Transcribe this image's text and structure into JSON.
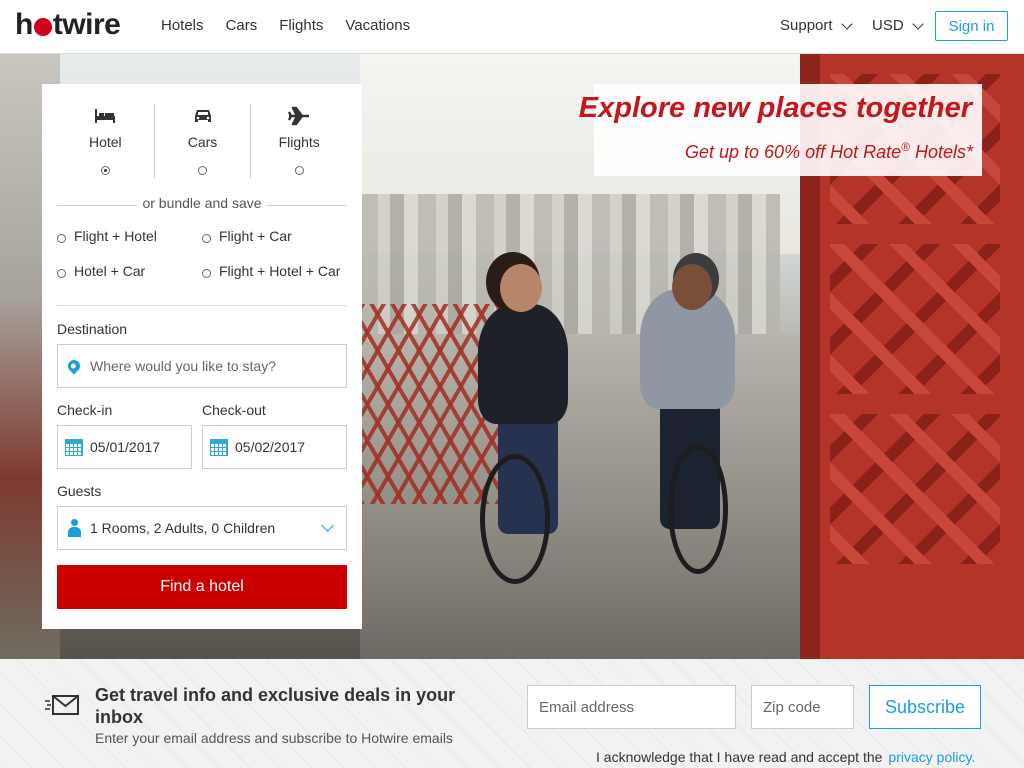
{
  "header": {
    "logo": "hotwire",
    "nav": [
      "Hotels",
      "Cars",
      "Flights",
      "Vacations"
    ],
    "support": "Support",
    "currency": "USD",
    "signin": "Sign in"
  },
  "promo": {
    "title": "Explore new places together",
    "subtitle": "Get up to 60% off Hot Rate",
    "subtitle_mark": "®",
    "subtitle_end": " Hotels*"
  },
  "search": {
    "tabs": [
      {
        "label": "Hotel",
        "icon": "bed-icon",
        "selected": true
      },
      {
        "label": "Cars",
        "icon": "car-icon",
        "selected": false
      },
      {
        "label": "Flights",
        "icon": "plane-icon",
        "selected": false
      }
    ],
    "bundle_label": "or bundle and save",
    "bundles": [
      "Flight + Hotel",
      "Flight + Car",
      "Hotel + Car",
      "Flight + Hotel + Car"
    ],
    "destination_label": "Destination",
    "destination_placeholder": "Where would you like to stay?",
    "checkin_label": "Check-in",
    "checkin_value": "05/01/2017",
    "checkout_label": "Check-out",
    "checkout_value": "05/02/2017",
    "guests_label": "Guests",
    "guests_value": "1 Rooms, 2 Adults, 0 Children",
    "submit": "Find a hotel"
  },
  "newsletter": {
    "title": "Get travel info and exclusive deals in your inbox",
    "subtitle": "Enter your email address and subscribe to Hotwire emails",
    "email_placeholder": "Email address",
    "zip_placeholder": "Zip code",
    "subscribe": "Subscribe",
    "ack_text": "I acknowledge that I have read and accept the",
    "privacy_link": "privacy policy."
  },
  "colors": {
    "brand_red": "#cc0000",
    "accent_blue": "#1a9fd6",
    "promo_red": "#c4161c"
  }
}
